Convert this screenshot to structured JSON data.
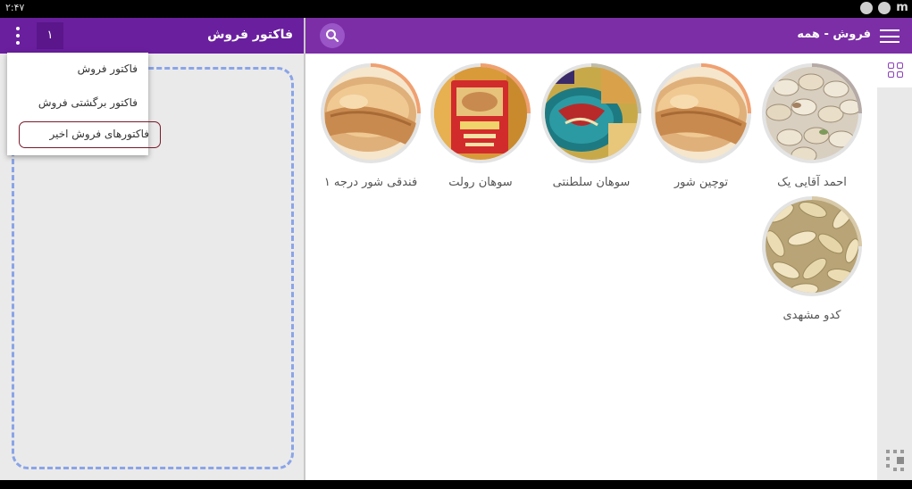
{
  "status": {
    "time": "۲:۴۷"
  },
  "left_panel": {
    "title": "فاکتور فروش",
    "counter": "۱",
    "menu": [
      "فاکتور فروش",
      "فاکتور برگشتی فروش",
      "فاکتورهای فروش اخیر"
    ]
  },
  "right_panel": {
    "title": "فروش - همه"
  },
  "products": [
    {
      "name": "احمد آقایی یک",
      "progress": 0.25,
      "ring_color": "#b5aaa6",
      "image": "pistachios-bowl"
    },
    {
      "name": "توچین شور",
      "progress": 0.25,
      "ring_color": "#f0a070",
      "image": "pistachio-closeup"
    },
    {
      "name": "سوهان سلطنتی",
      "progress": 0.25,
      "ring_color": "#bfbcab",
      "image": "sohan-tin"
    },
    {
      "name": "سوهان رولت",
      "progress": 0.25,
      "ring_color": "#f0a070",
      "image": "sohan-box"
    },
    {
      "name": "فندقی شور درجه ۱",
      "progress": 0.25,
      "ring_color": "#f0a070",
      "image": "pistachio-closeup"
    },
    {
      "name": "کدو مشهدی",
      "progress": 0.25,
      "ring_color": "#d8c9a8",
      "image": "pumpkin-seeds"
    }
  ]
}
